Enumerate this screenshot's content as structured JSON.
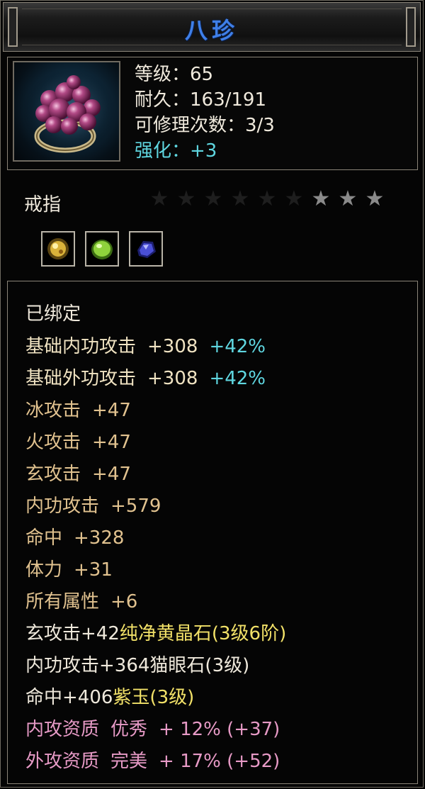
{
  "title": "八珍",
  "stats": {
    "level": "等级：65",
    "durability": "耐久：163/191",
    "repair": "可修理次数：3/3",
    "enhance": "强化：+3"
  },
  "category": "戒指",
  "stars": {
    "total": 9,
    "lit": 3
  },
  "gem_slots": [
    {
      "name": "yellow-gem-icon",
      "color": "#d9b23a"
    },
    {
      "name": "green-gem-icon",
      "color": "#8fd23c"
    },
    {
      "name": "blue-gem-icon",
      "color": "#4a4fd6"
    }
  ],
  "bound": "已绑定",
  "base_attrs": [
    {
      "label": "基础内功攻击",
      "value": "+308",
      "extra": "+42%"
    },
    {
      "label": "基础外功攻击",
      "value": "+308",
      "extra": "+42%"
    }
  ],
  "attrs": [
    {
      "label": "冰攻击",
      "value": "+47"
    },
    {
      "label": "火攻击",
      "value": "+47"
    },
    {
      "label": "玄攻击",
      "value": "+47"
    },
    {
      "label": "内功攻击",
      "value": "+579"
    },
    {
      "label": "命中",
      "value": "+328"
    },
    {
      "label": "体力",
      "value": "+31"
    },
    {
      "label": "所有属性",
      "value": "+6"
    }
  ],
  "gems_lines": [
    {
      "prefix": "玄攻击+42",
      "gem": "纯净黄晶石(3级6阶)"
    },
    {
      "prefix": "内功攻击+364",
      "gem": "猫眼石(3级)"
    },
    {
      "prefix": "命中+406",
      "gem": "紫玉(3级)"
    }
  ],
  "quality": [
    {
      "label": "内攻资质",
      "grade": "优秀",
      "value": "+ 12% (+37)"
    },
    {
      "label": "外攻资质",
      "grade": "完美",
      "value": "+ 17% (+52)"
    }
  ],
  "colors": {
    "title": "#3f7fe8",
    "cyan": "#5fd6e0",
    "tan": "#e1c28f",
    "yellow": "#f2e168",
    "pink": "#e79ac6"
  }
}
